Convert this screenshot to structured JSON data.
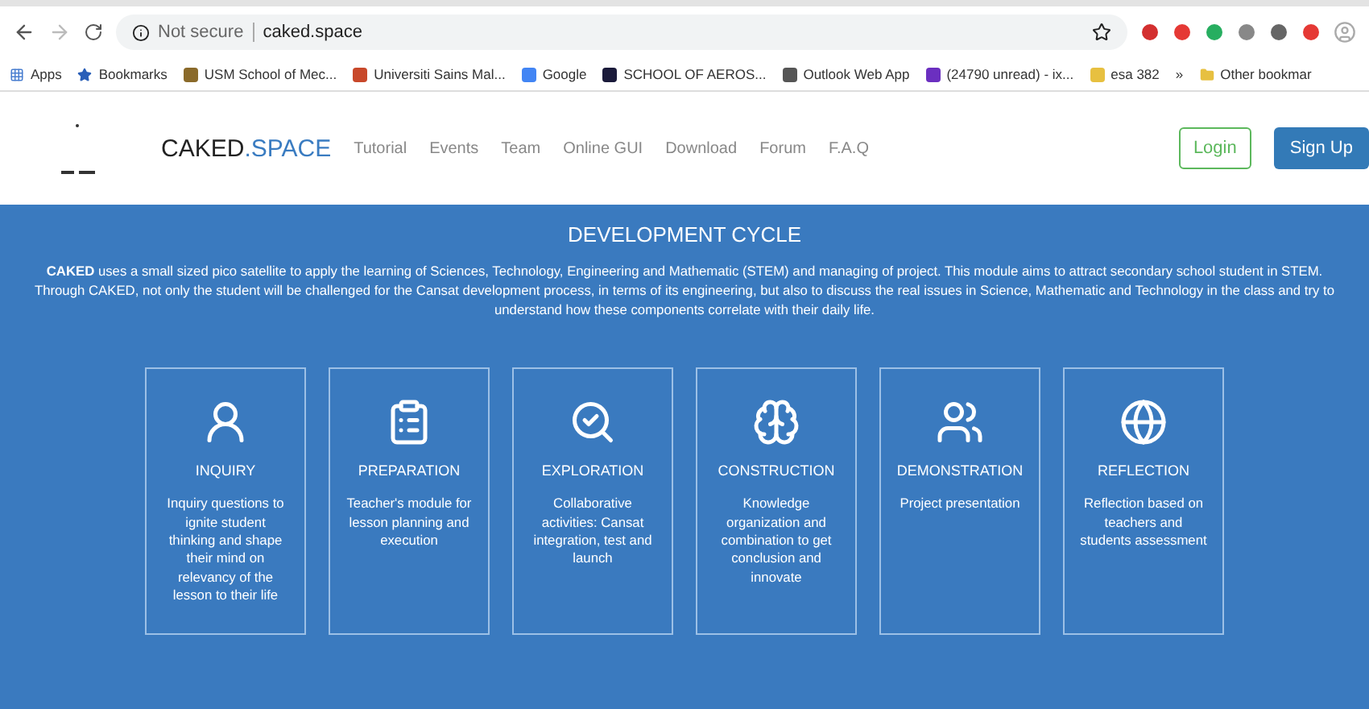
{
  "browser": {
    "address_prefix": "Not secure",
    "address": "caked.space",
    "bookmarks": [
      {
        "label": "Apps"
      },
      {
        "label": "Bookmarks"
      },
      {
        "label": "USM School of Mec..."
      },
      {
        "label": "Universiti Sains Mal..."
      },
      {
        "label": "Google"
      },
      {
        "label": "SCHOOL OF AEROS..."
      },
      {
        "label": "Outlook Web App"
      },
      {
        "label": "(24790 unread) - ix..."
      },
      {
        "label": "esa 382"
      }
    ],
    "overflow": "»",
    "other_bookmarks": "Other bookmar"
  },
  "site": {
    "brand_main": "CAKED",
    "brand_accent": ".SPACE",
    "nav": [
      "Tutorial",
      "Events",
      "Team",
      "Online GUI",
      "Download",
      "Forum",
      "F.A.Q"
    ],
    "login": "Login",
    "signup": "Sign Up"
  },
  "section": {
    "title": "DEVELOPMENT CYCLE",
    "intro": "**CAKED** uses a small sized pico satellite to apply the learning of Sciences, Technology, Engineering and Mathematic (STEM) and managing of project. This module aims to attract secondary school student in STEM. Through CAKED, not only the student will be challenged for the Cansat development process, in terms of its engineering, but also to discuss the real issues in Science, Mathematic and Technology in the class and try to understand how these components correlate with their daily life.",
    "cards": [
      {
        "title": "INQUIRY",
        "text": "Inquiry questions to ignite student thinking and shape their mind on relevancy of the lesson to their life"
      },
      {
        "title": "PREPARATION",
        "text": "Teacher's module for lesson planning and execution"
      },
      {
        "title": "EXPLORATION",
        "text": "Collaborative activities: Cansat integration, test and launch"
      },
      {
        "title": "CONSTRUCTION",
        "text": "Knowledge organization and combination to get conclusion and innovate"
      },
      {
        "title": "DEMONSTRATION",
        "text": "Project presentation"
      },
      {
        "title": "REFLECTION",
        "text": "Reflection based on teachers and students assessment"
      }
    ]
  }
}
